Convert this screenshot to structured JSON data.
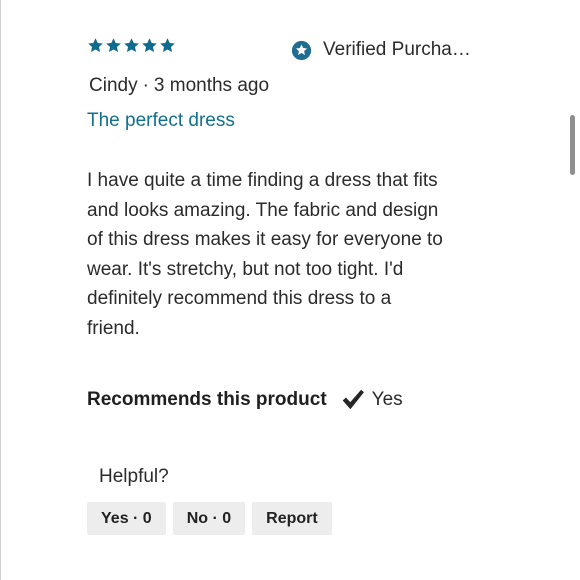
{
  "review": {
    "rating": 5,
    "rating_max": 5,
    "star_color": "#0f6c8f",
    "verified_label": "Verified Purcha…",
    "reviewer": "Cindy",
    "separator": "·",
    "time_ago": "3 months ago",
    "title": "The perfect dress",
    "title_color": "#12708f",
    "body": "I have quite a time finding a dress that fits and looks amazing. The fabric and design of this dress makes it easy for everyone to wear. It's stretchy, but not too tight. I'd definitely recommend this dress to a friend."
  },
  "recommends": {
    "label": "Recommends this product",
    "value": "Yes",
    "icon": "checkmark-icon"
  },
  "feedback": {
    "prompt": "Helpful?",
    "yes_label": "Yes · 0",
    "no_label": "No · 0",
    "report_label": "Report"
  }
}
